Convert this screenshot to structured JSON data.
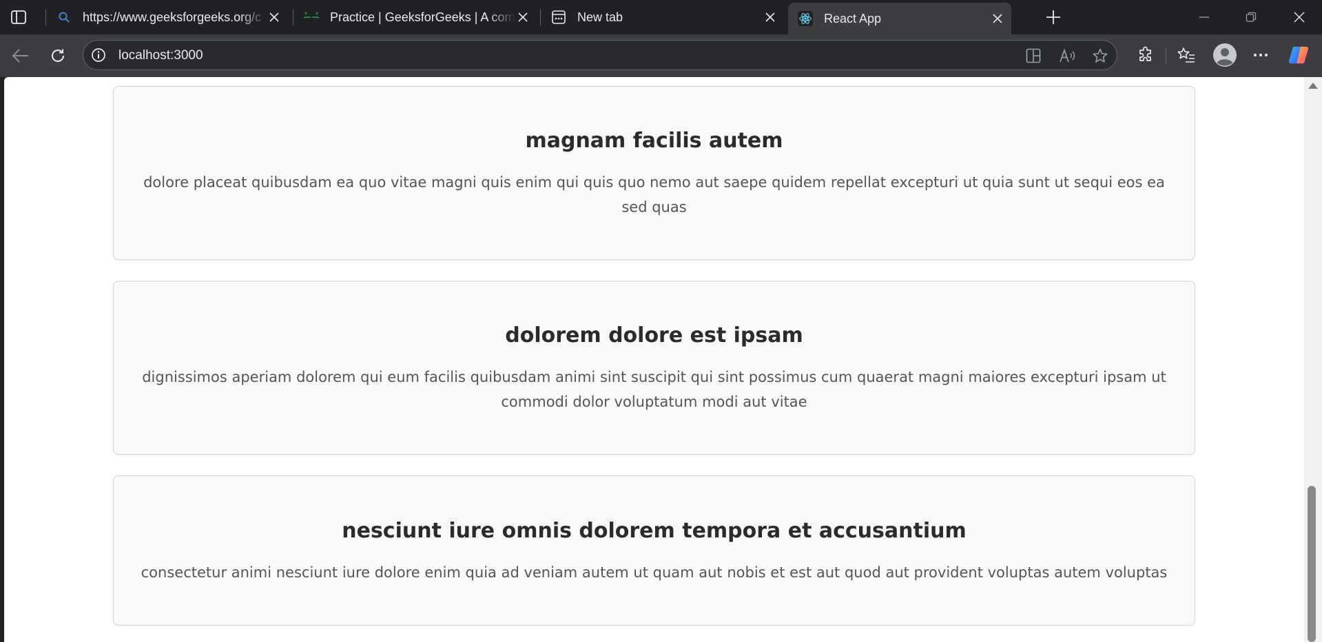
{
  "browser": {
    "tabs": [
      {
        "title": "https://www.geeksforgeeks.org/c",
        "favicon": "search-icon",
        "active": false
      },
      {
        "title": "Practice | GeeksforGeeks | A comp",
        "favicon": "geeksforgeeks-logo-icon",
        "active": false
      },
      {
        "title": "New tab",
        "favicon": "new-tab-page-icon",
        "active": false
      },
      {
        "title": "React App",
        "favicon": "react-logo-icon",
        "active": true
      }
    ],
    "address": "localhost:3000"
  },
  "posts": [
    {
      "title": "magnam facilis autem",
      "body_line1": "dolore placeat quibusdam ea quo vitae magni quis enim qui quis quo nemo aut saepe quidem repellat excepturi ut quia sunt ut sequi eos ea",
      "body_line2": "sed quas"
    },
    {
      "title": "dolorem dolore est ipsam",
      "body_line1": "dignissimos aperiam dolorem qui eum facilis quibusdam animi sint suscipit qui sint possimus cum quaerat magni maiores excepturi ipsam ut",
      "body_line2": "commodi dolor voluptatum modi aut vitae"
    },
    {
      "title": "nesciunt iure omnis dolorem tempora et accusantium",
      "body_line1": "consectetur animi nesciunt iure dolore enim quia ad veniam autem ut quam aut nobis et est aut quod aut provident voluptas autem voluptas",
      "body_line2": ""
    }
  ],
  "colors": {
    "tabstrip_bg": "#202124",
    "toolbar_bg": "#3c3d41",
    "card_bg": "#f9f9f9",
    "card_border": "#d6d6d6",
    "title_text": "#2b2b2b",
    "body_text": "#555555",
    "react_accent": "#61dafb",
    "gfg_accent": "#2f8d46"
  }
}
